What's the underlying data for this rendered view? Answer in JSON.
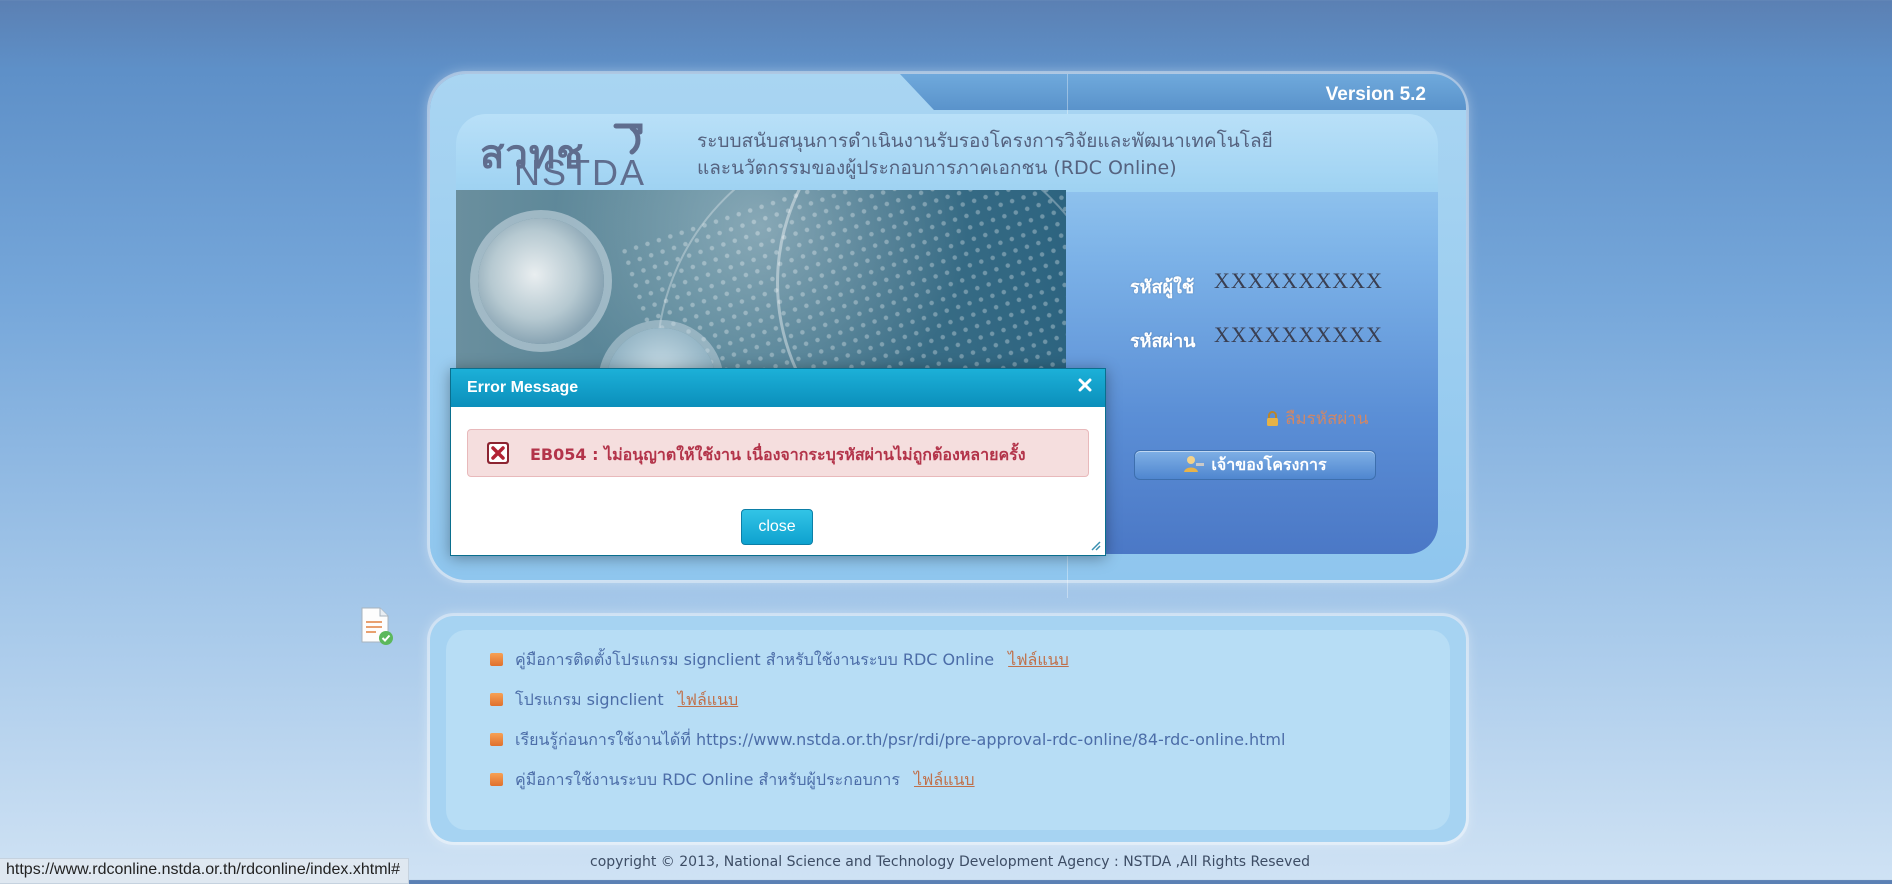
{
  "header": {
    "version": "Version 5.2",
    "logo_thai": "สวทช",
    "logo_en": "NSTDA",
    "title_line1": "ระบบสนับสนุนการดำเนินงานรับรองโครงการวิจัยและพัฒนาเทคโนโลยี",
    "title_line2": "และนวัตกรรมของผู้ประกอบการภาคเอกชน (RDC Online)"
  },
  "login": {
    "username_label": "รหัสผู้ใช้",
    "username_value": "XXXXXXXXXX",
    "password_label": "รหัสผ่าน",
    "password_value": "XXXXXXXXXX",
    "forgot_password": "ลืมรหัสผ่าน",
    "owner_button": "เจ้าของโครงการ"
  },
  "dialog": {
    "title": "Error Message",
    "message": "EB054 : ไม่อนุญาตให้ใช้งาน เนื่องจากระบุรหัสผ่านไม่ถูกต้องหลายครั้ง",
    "close_label": "close"
  },
  "links": [
    {
      "text": "คู่มือการติดตั้งโปรแกรม signclient สำหรับใช้งานระบบ RDC Online",
      "attachment": "ไฟล์แนบ"
    },
    {
      "text": "โปรแกรม signclient",
      "attachment": "ไฟล์แนบ"
    },
    {
      "text": "เรียนรู้ก่อนการใช้งานได้ที่ https://www.nstda.or.th/psr/rdi/pre-approval-rdc-online/84-rdc-online.html",
      "attachment": ""
    },
    {
      "text": "คู่มือการใช้งานระบบ RDC Online สำหรับผู้ประกอบการ",
      "attachment": "ไฟล์แนบ"
    }
  ],
  "footer": {
    "copyright": "copyright © 2013, National Science and Technology Development Agency : NSTDA ,All Rights Reseved"
  },
  "status_bar": {
    "url": "https://www.rdconline.nstda.or.th/rdconline/index.xhtml#"
  },
  "colors": {
    "dialog_header": "#0b9fc8",
    "error_text": "#b3344a",
    "link_text": "#4c6da8",
    "attachment_link": "#c0704a"
  }
}
